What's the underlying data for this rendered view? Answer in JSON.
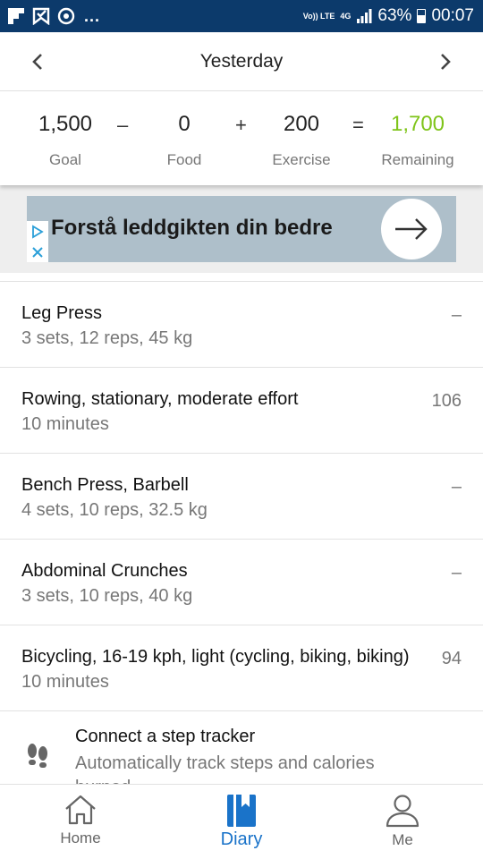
{
  "status_bar": {
    "volte": "Vo)) LTE",
    "network": "4G",
    "battery": "63%",
    "time": "00:07",
    "icons": [
      "flipboard-icon",
      "tasks-icon",
      "sync-icon"
    ]
  },
  "header": {
    "title": "Yesterday"
  },
  "summary": {
    "goal_value": "1,500",
    "goal_label": "Goal",
    "minus": "–",
    "food_value": "0",
    "food_label": "Food",
    "plus": "+",
    "exercise_value": "200",
    "exercise_label": "Exercise",
    "equals": "=",
    "remaining_value": "1,700",
    "remaining_label": "Remaining",
    "remaining_color": "#7fc41a"
  },
  "ad": {
    "text": "Forstå leddgikten din bedre"
  },
  "exercises": [
    {
      "name": "Leg Press",
      "detail": "3 sets, 12 reps, 45 kg",
      "calories": "–"
    },
    {
      "name": "Rowing, stationary, moderate effort",
      "detail": "10 minutes",
      "calories": "106"
    },
    {
      "name": "Bench Press, Barbell",
      "detail": "4 sets, 10 reps, 32.5 kg",
      "calories": "–"
    },
    {
      "name": "Abdominal Crunches",
      "detail": "3 sets, 10 reps, 40 kg",
      "calories": "–"
    },
    {
      "name": "Bicycling, 16-19 kph, light (cycling, biking, biking)",
      "detail": "10 minutes",
      "calories": "94"
    }
  ],
  "step_tracker": {
    "title": "Connect a step tracker",
    "subtitle": "Automatically track steps and calories burned"
  },
  "bottom_nav": {
    "home": "Home",
    "diary": "Diary",
    "me": "Me",
    "active_color": "#1a73c9"
  }
}
